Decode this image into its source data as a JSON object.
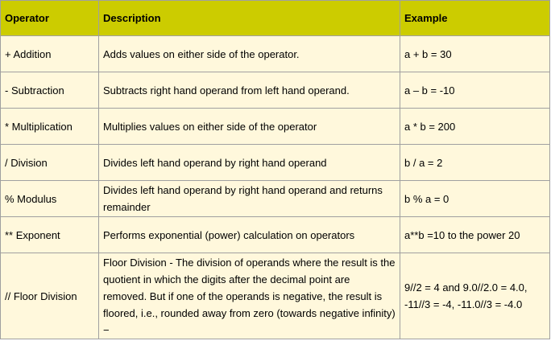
{
  "table": {
    "headers": [
      "Operator",
      "Description",
      "Example"
    ],
    "rows": [
      {
        "operator": "+ Addition",
        "description": "Adds values on either side of the operator.",
        "example": "a + b = 30"
      },
      {
        "operator": "- Subtraction",
        "description": "Subtracts right hand operand from left hand operand.",
        "example": "a – b = -10"
      },
      {
        "operator": "* Multiplication",
        "description": "Multiplies values on either side of the operator",
        "example": "a * b = 200"
      },
      {
        "operator": "/ Division",
        "description": "Divides left hand operand by right hand operand",
        "example": "b / a = 2"
      },
      {
        "operator": "% Modulus",
        "description": "Divides left hand operand by right hand operand and returns remainder",
        "example": "b % a = 0"
      },
      {
        "operator": "** Exponent",
        "description": "Performs exponential (power) calculation on operators",
        "example": "a**b =10 to the power 20"
      },
      {
        "operator": "// Floor Division",
        "description": "Floor Division - The division of operands where the result is the quotient in which the digits after the decimal point are removed. But if one of the operands is negative, the result is floored, i.e., rounded away from zero (towards negative infinity) −",
        "example": "9//2 = 4 and 9.0//2.0 = 4.0, -11//3 = -4, -11.0//3 = -4.0"
      }
    ]
  }
}
